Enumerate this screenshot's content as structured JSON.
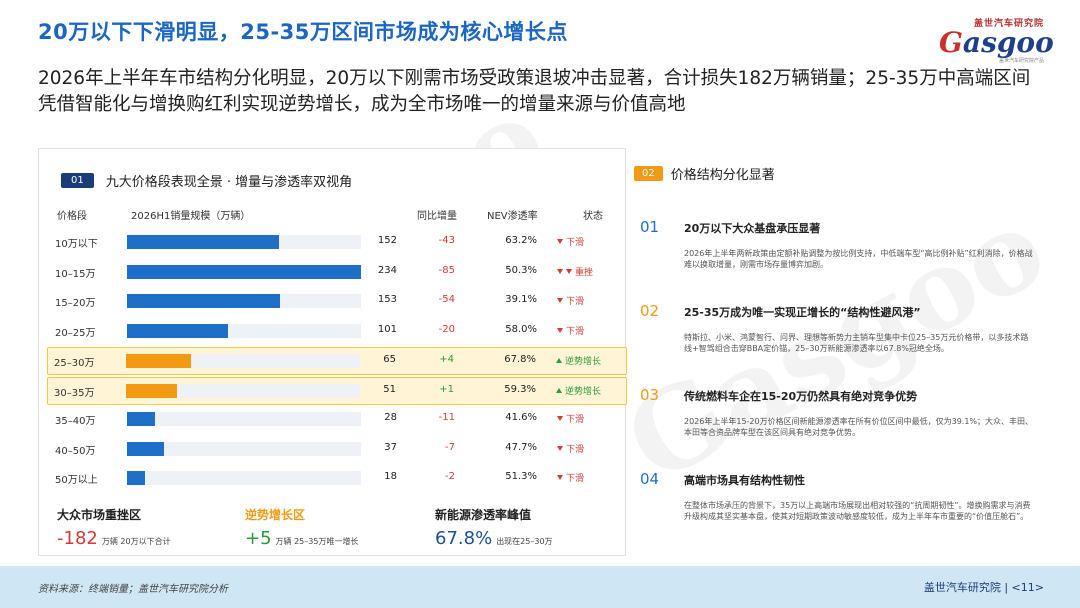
{
  "header": {
    "title": "20万以下下滑明显，25-35万区间市场成为核心增长点",
    "subtitle": "2026年上半年车市结构分化明显，20万以下刚需市场受政策退坡冲击显著，合计损失182万辆销量；25-35万中高端区间凭借智能化与增换购红利实现逆势增长，成为全市场唯一的增量来源与价值高地"
  },
  "logo": {
    "top": "盖世汽车研究院",
    "word_g": "G",
    "word_rest": "asgoo",
    "tag": "盖世汽车研究院产品"
  },
  "left_panel": {
    "badge": "01",
    "title": "九大价格段表现全景 · 增量与渗透率双视角",
    "headers": {
      "segment": "价格段",
      "volume": "2026H1销量规模（万辆）",
      "yoy": "同比增量",
      "nev": "NEV渗透率",
      "status": "状态"
    },
    "rows": [
      {
        "seg": "10万以下",
        "vol": 152,
        "vol_label": "152",
        "yoy": "-43",
        "nev": "63.2%",
        "status": "下滑",
        "kind": "down",
        "hl": false
      },
      {
        "seg": "10–15万",
        "vol": 234,
        "vol_label": "234",
        "yoy": "-85",
        "nev": "50.3%",
        "status": "重挫",
        "kind": "down2",
        "hl": false
      },
      {
        "seg": "15–20万",
        "vol": 153,
        "vol_label": "153",
        "yoy": "-54",
        "nev": "39.1%",
        "status": "下滑",
        "kind": "down",
        "hl": false
      },
      {
        "seg": "20–25万",
        "vol": 101,
        "vol_label": "101",
        "yoy": "-20",
        "nev": "58.0%",
        "status": "下滑",
        "kind": "down",
        "hl": false
      },
      {
        "seg": "25–30万",
        "vol": 65,
        "vol_label": "65",
        "yoy": "+4",
        "nev": "67.8%",
        "status": "逆势增长",
        "kind": "up",
        "hl": true
      },
      {
        "seg": "30–35万",
        "vol": 51,
        "vol_label": "51",
        "yoy": "+1",
        "nev": "59.3%",
        "status": "逆势增长",
        "kind": "up",
        "hl": true
      },
      {
        "seg": "35–40万",
        "vol": 28,
        "vol_label": "28",
        "yoy": "-11",
        "nev": "41.6%",
        "status": "下滑",
        "kind": "down",
        "hl": false
      },
      {
        "seg": "40–50万",
        "vol": 37,
        "vol_label": "37",
        "yoy": "-7",
        "nev": "47.7%",
        "status": "下滑",
        "kind": "down",
        "hl": false
      },
      {
        "seg": "50万以上",
        "vol": 18,
        "vol_label": "18",
        "yoy": "-2",
        "nev": "51.3%",
        "status": "下滑",
        "kind": "down",
        "hl": false
      }
    ],
    "vol_max": 234,
    "stats": [
      {
        "label": "大众市场重挫区",
        "num": "-182",
        "unit": "万辆 20万以下合计"
      },
      {
        "label": "逆势增长区",
        "num": "+5",
        "unit": "万辆 25–35万唯一增长"
      },
      {
        "label": "新能源渗透率峰值",
        "num": "67.8%",
        "unit": "出现在25–30万"
      }
    ]
  },
  "right_panel": {
    "badge": "02",
    "title": "价格结构分化显著",
    "items": [
      {
        "no": "01",
        "head": "20万以下大众基盘承压显著",
        "desc": "2026年上半年两新政策由定额补贴调整为按比例支持，中低端车型“高比例补贴”红利消除，价格战难以换取增量，刚需市场存量博弈加剧。"
      },
      {
        "no": "02",
        "head": "25-35万成为唯一实现正增长的“结构性避风港”",
        "desc": "特斯拉、小米、鸿蒙智行、问界、理想等新势力主销车型集中卡位25–35万元价格带，以多技术路线+智驾组合击穿BBA定价锚，25–30万新能源渗透率以67.8%冠绝全场。"
      },
      {
        "no": "03",
        "head": "传统燃料车企在15-20万仍然具有绝对竞争优势",
        "desc": "2026年上半年15-20万价格区间新能源渗透率在所有价位区间中最低，仅为39.1%；大众、丰田、本田等合资品牌车型在该区间具有绝对竞争优势。"
      },
      {
        "no": "04",
        "head": "高端市场具有结构性韧性",
        "desc": "在整体市场承压的背景下，35万以上高端市场展现出相对较强的“抗周期韧性”。增换购需求与消费升级构成其坚实基本盘，使其对短期政策波动敏感度较低，成为上半年车市重要的“价值压舱石”。"
      }
    ]
  },
  "footer": {
    "source": "资料来源：终端销量；盖世汽车研究院分析",
    "org": "盖世汽车研究院 | <11>"
  },
  "watermark": "Gasgoo",
  "colors": {
    "primary_blue": "#1d6fc7",
    "title_blue": "#1a66c2",
    "orange": "#f29a13",
    "down_red": "#d23a32",
    "up_green": "#2a9a3c",
    "navy": "#1a3d7a"
  }
}
